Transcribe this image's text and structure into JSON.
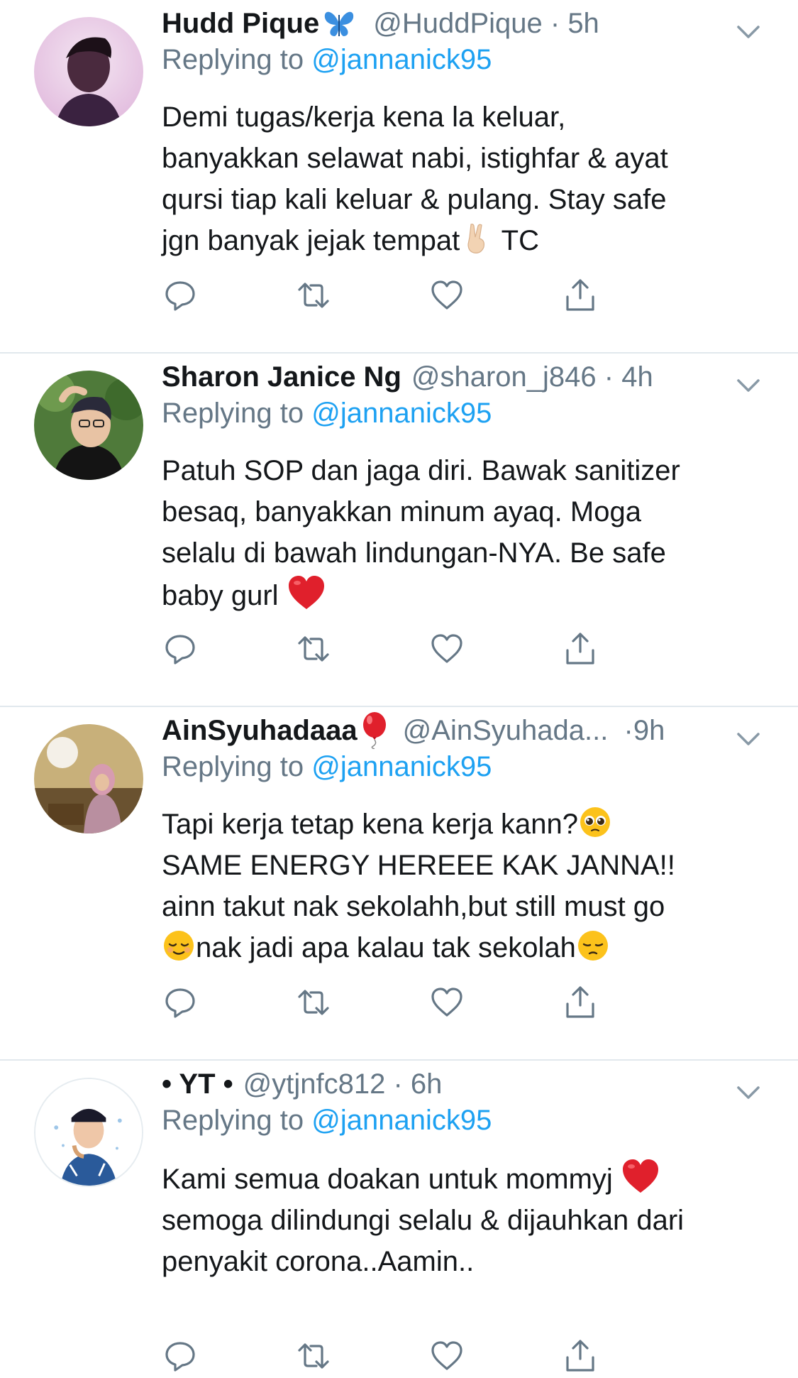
{
  "accent_color": "#1da1f2",
  "tweets": [
    {
      "name": "Hudd Pique",
      "name_icon": "butterfly-icon",
      "handle": "@HuddPique",
      "time": "5h",
      "replying_label": "Replying to",
      "replying_to": "@jannanick95",
      "body": [
        "Demi tugas/kerja kena la keluar,",
        "banyakkan selawat nabi, istighfar & ayat",
        "qursi tiap kali keluar & pulang. Stay safe",
        "jgn banyak jejak tempat",
        " TC"
      ],
      "emoji": [
        "victory-hand-icon"
      ]
    },
    {
      "name": "Sharon Janice Ng",
      "handle": "@sharon_j846",
      "time": "4h",
      "replying_label": "Replying to",
      "replying_to": "@jannanick95",
      "body": [
        "Patuh SOP dan jaga diri. Bawak sanitizer",
        "besaq, banyakkan minum ayaq. Moga",
        "selalu di bawah lindungan-NYA. Be safe",
        "baby gurl "
      ],
      "emoji": [
        "red-heart-icon"
      ]
    },
    {
      "name": "AinSyuhadaaa",
      "name_icon": "balloon-icon",
      "handle": "@AinSyuhada...",
      "time": "9h",
      "replying_label": "Replying to",
      "replying_to": "@jannanick95",
      "body": [
        "Tapi kerja tetap kena kerja kann?",
        "SAME ENERGY HEREEE KAK JANNA!!",
        "ainn takut nak sekolahh,but still must go",
        "nak jadi apa kalau tak sekolah"
      ],
      "emoji": [
        "pleading-face-icon",
        "relieved-face-icon",
        "pensive-face-icon"
      ]
    },
    {
      "name": "• YT •",
      "handle": "@ytjnfc812",
      "time": "6h",
      "replying_label": "Replying to",
      "replying_to": "@jannanick95",
      "body": [
        "Kami semua doakan untuk mommyj ",
        "semoga dilindungi selalu & dijauhkan dari",
        "penyakit corona..Aamin.."
      ],
      "emoji": [
        "red-heart-icon"
      ]
    }
  ]
}
